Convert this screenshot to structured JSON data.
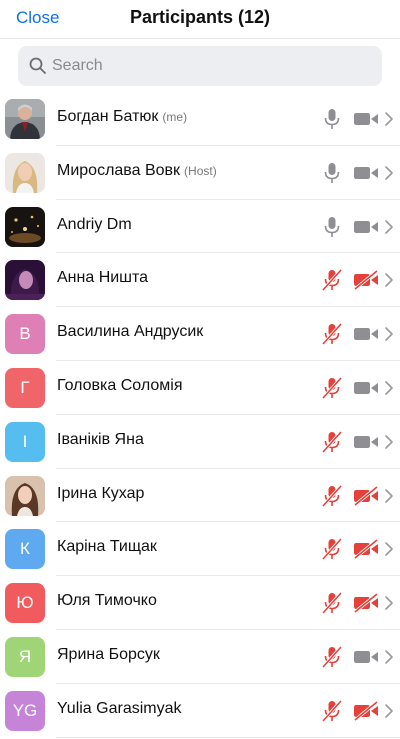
{
  "header": {
    "close_label": "Close",
    "title": "Participants (12)"
  },
  "search": {
    "placeholder": "Search"
  },
  "colors": {
    "accent": "#0e71eb",
    "muted_red": "#e5403a",
    "icon_gray": "#8e8e93"
  },
  "participants": [
    {
      "name": "Богдан Батюк",
      "role": "(me)",
      "initial": "",
      "avatar": "photo-man",
      "mic_muted": false,
      "video_off": false
    },
    {
      "name": "Мирослава Вовк",
      "role": "(Host)",
      "initial": "",
      "avatar": "photo-blonde",
      "mic_muted": false,
      "video_off": false
    },
    {
      "name": "Andriy Dm",
      "role": "",
      "initial": "",
      "avatar": "photo-dark",
      "mic_muted": false,
      "video_off": false
    },
    {
      "name": "Анна Ништа",
      "role": "",
      "initial": "",
      "avatar": "photo-purple",
      "mic_muted": true,
      "video_off": true
    },
    {
      "name": "Василина Андрусик",
      "role": "",
      "initial": "В",
      "avatar": "#de7fb6",
      "mic_muted": true,
      "video_off": false
    },
    {
      "name": "Головка Соломія",
      "role": "",
      "initial": "Г",
      "avatar": "#f0656a",
      "mic_muted": true,
      "video_off": false
    },
    {
      "name": "Іваніків Яна",
      "role": "",
      "initial": "І",
      "avatar": "#56bdf0",
      "mic_muted": true,
      "video_off": false
    },
    {
      "name": "Ірина Кухар",
      "role": "",
      "initial": "",
      "avatar": "photo-brunette",
      "mic_muted": true,
      "video_off": true
    },
    {
      "name": "Каріна Тищак",
      "role": "",
      "initial": "К",
      "avatar": "#5ea9f0",
      "mic_muted": true,
      "video_off": true
    },
    {
      "name": "Юля Тимочко",
      "role": "",
      "initial": "Ю",
      "avatar": "#f25b5e",
      "mic_muted": true,
      "video_off": true
    },
    {
      "name": "Ярина Борсук",
      "role": "",
      "initial": "Я",
      "avatar": "#9fd477",
      "mic_muted": true,
      "video_off": false
    },
    {
      "name": "Yulia Garasimyak",
      "role": "",
      "initial": "YG",
      "avatar": "#c584d8",
      "mic_muted": true,
      "video_off": true
    }
  ]
}
